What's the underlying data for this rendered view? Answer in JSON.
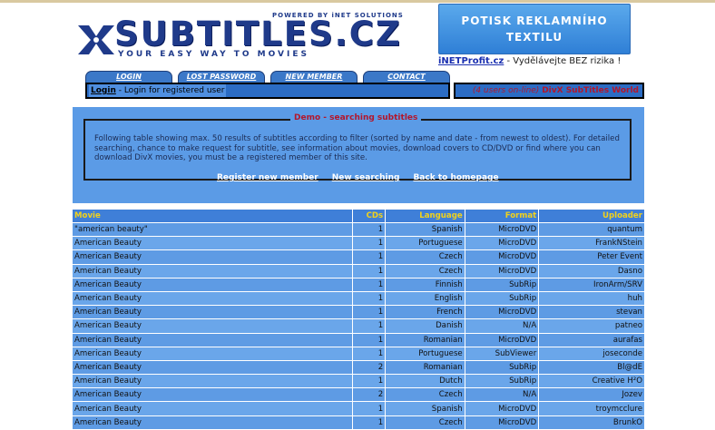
{
  "header": {
    "powered": "POWERED BY iNET SOLUTIONS",
    "brand": "SUBTITLES.CZ",
    "tagline": "YOUR EASY WAY TO MOVIES",
    "banner_line1": "POTISK REKLAMNÍHO",
    "banner_line2": "TEXTILU",
    "promo_link": "iNETProfit.cz",
    "promo_text": " - Vydělávejte BEZ rizika !"
  },
  "tabs": [
    "LOGIN",
    "LOST PASSWORD",
    "NEW MEMBER",
    "CONTACT"
  ],
  "loginbar": {
    "label": "Login",
    "text": " - Login for registered user"
  },
  "status": {
    "users": "(4 users on-line)",
    "site": "DivX SubTitles World"
  },
  "demo": {
    "title": "Demo - searching subtitles",
    "text": "Following table showing max. 50 results of subtitles according to filter (sorted by name and date - from newest to oldest). For detailed searching, chance to make request for subtitle, see information about movies, download covers to CD/DVD or find where you can download DivX movies, you must be a registered member of this site.",
    "links": [
      "Register new member",
      "New searching",
      "Back to homepage"
    ]
  },
  "table": {
    "headers": [
      "Movie",
      "CDs",
      "Language",
      "Format",
      "Uploader"
    ],
    "rows": [
      [
        "\"american beauty\"",
        "1",
        "Spanish",
        "MicroDVD",
        "quantum"
      ],
      [
        "American Beauty",
        "1",
        "Portuguese",
        "MicroDVD",
        "FrankNStein"
      ],
      [
        "American Beauty",
        "1",
        "Czech",
        "MicroDVD",
        "Peter Event"
      ],
      [
        "American Beauty",
        "1",
        "Czech",
        "MicroDVD",
        "Dasno"
      ],
      [
        "American Beauty",
        "1",
        "Finnish",
        "SubRip",
        "IronArm/SRV"
      ],
      [
        "American Beauty",
        "1",
        "English",
        "SubRip",
        "huh"
      ],
      [
        "American Beauty",
        "1",
        "French",
        "MicroDVD",
        "stevan"
      ],
      [
        "American Beauty",
        "1",
        "Danish",
        "N/A",
        "patneo"
      ],
      [
        "American Beauty",
        "1",
        "Romanian",
        "MicroDVD",
        "aurafas"
      ],
      [
        "American Beauty",
        "1",
        "Portuguese",
        "SubViewer",
        "joseconde"
      ],
      [
        "American Beauty",
        "2",
        "Romanian",
        "SubRip",
        "Bl@dE"
      ],
      [
        "American Beauty",
        "1",
        "Dutch",
        "SubRip",
        "Creative H²O"
      ],
      [
        "American Beauty",
        "2",
        "Czech",
        "N/A",
        "Jozev"
      ],
      [
        "American Beauty",
        "1",
        "Spanish",
        "MicroDVD",
        "troymcclure"
      ],
      [
        "American Beauty",
        "1",
        "Czech",
        "MicroDVD",
        "BrunkO"
      ]
    ]
  }
}
